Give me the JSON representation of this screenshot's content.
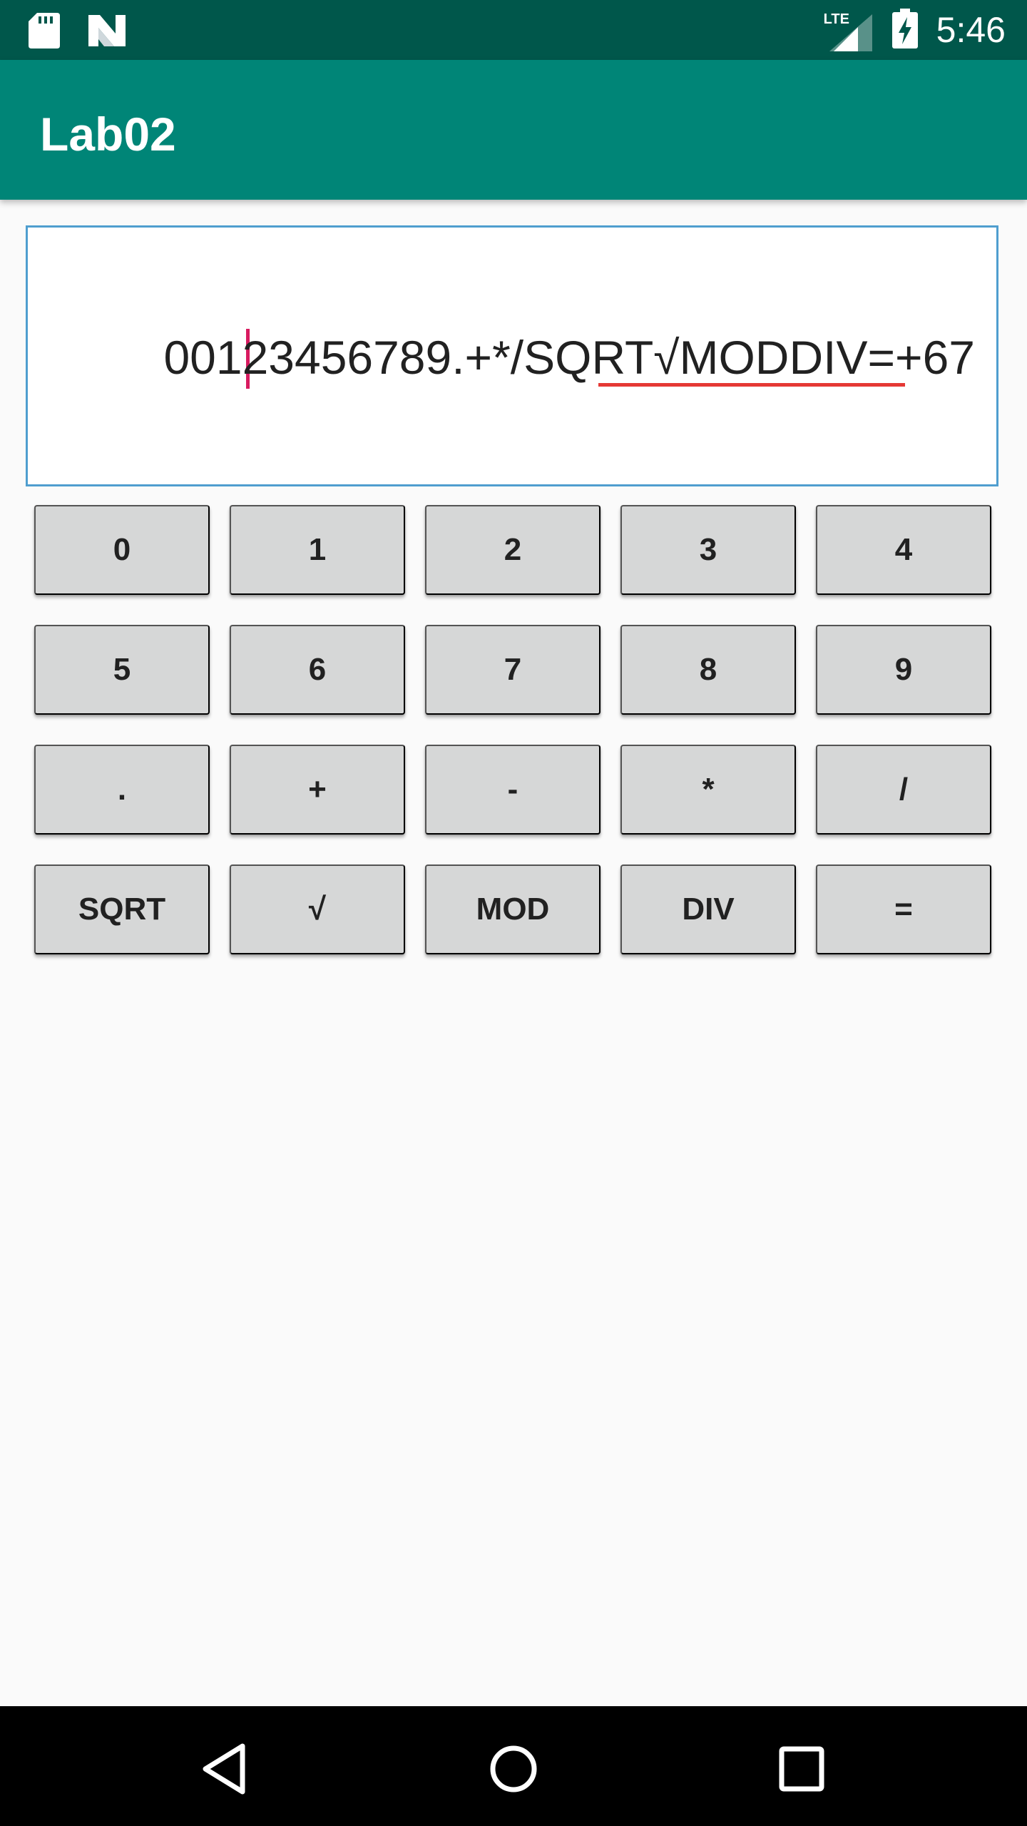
{
  "status_bar": {
    "time": "5:46",
    "network": "LTE",
    "icons": [
      "sd-card-icon",
      "n-logo-icon",
      "lte-signal-icon",
      "battery-charging-icon"
    ]
  },
  "app_bar": {
    "title": "Lab02",
    "color": "#008577"
  },
  "display": {
    "value": "00123456789.+*/SQRT√MODDIV=+67"
  },
  "keypad": {
    "keys": [
      "0",
      "1",
      "2",
      "3",
      "4",
      "5",
      "6",
      "7",
      "8",
      "9",
      ".",
      "+",
      "-",
      "*",
      "/",
      "SQRT",
      "√",
      "MOD",
      "DIV",
      "="
    ]
  },
  "nav_bar": {
    "icons": [
      "back-icon",
      "home-icon",
      "recents-icon"
    ]
  }
}
